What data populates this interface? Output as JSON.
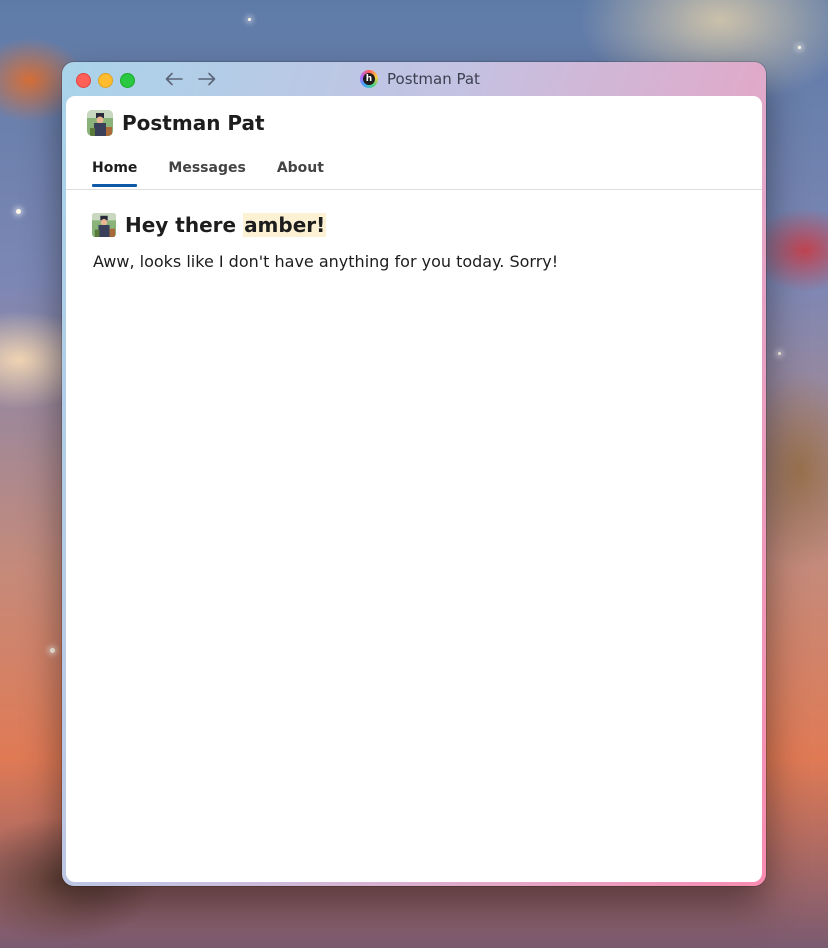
{
  "window": {
    "title": "Postman Pat",
    "app_icon_letter": "h"
  },
  "header": {
    "site_title": "Postman Pat"
  },
  "tabs": [
    {
      "label": "Home",
      "active": true
    },
    {
      "label": "Messages",
      "active": false
    },
    {
      "label": "About",
      "active": false
    }
  ],
  "main": {
    "greeting_prefix": "Hey there ",
    "username": "amber",
    "greeting_suffix": "!",
    "message": "Aww, looks like I don't have anything for you today. Sorry!"
  },
  "icons": {
    "back": "arrow-left-icon",
    "forward": "arrow-right-icon",
    "logo": "postman-avatar-icon"
  },
  "colors": {
    "tab_active_underline": "#0e5aa8",
    "username_highlight": "#fdf1d4"
  }
}
